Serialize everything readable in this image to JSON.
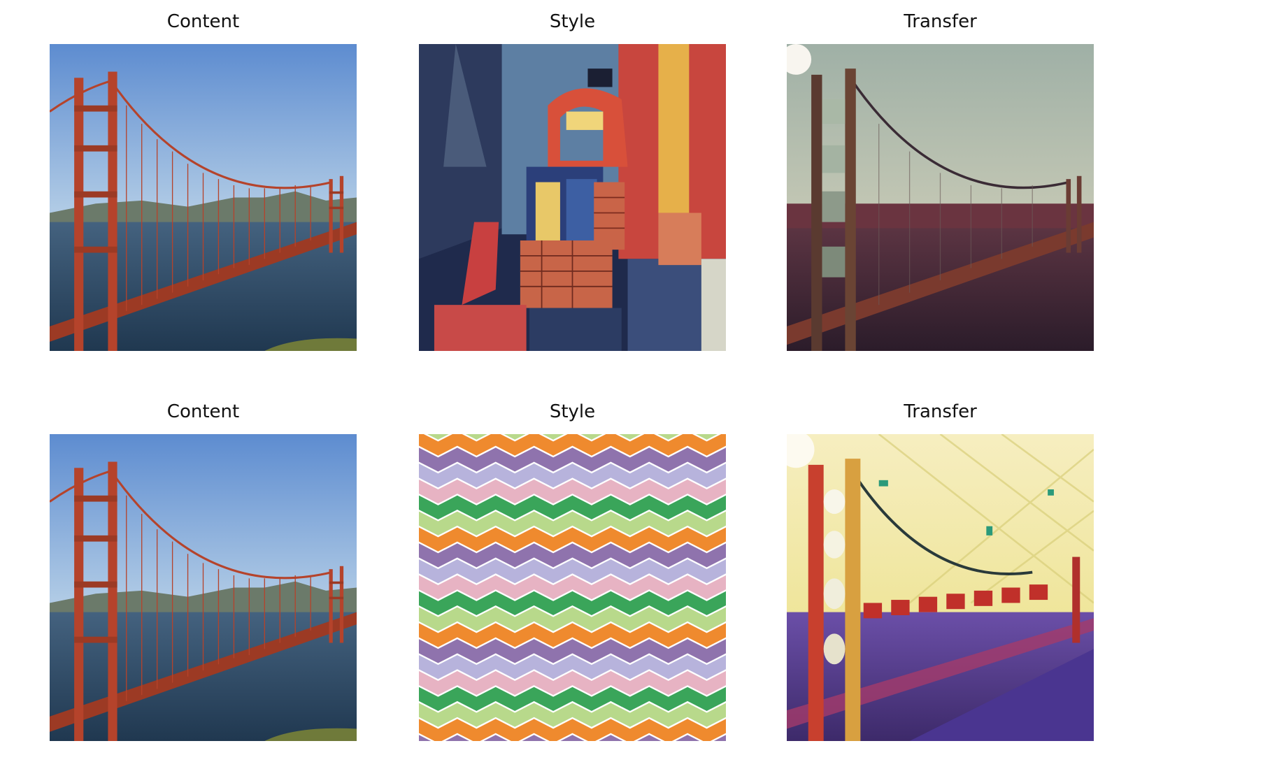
{
  "figure": {
    "panels": [
      {
        "title": "Content",
        "image": "golden-gate-bridge-photo"
      },
      {
        "title": "Style",
        "image": "cubist-painting"
      },
      {
        "title": "Transfer",
        "image": "bridge-cubist-stylized"
      },
      {
        "title": "Content",
        "image": "golden-gate-bridge-photo"
      },
      {
        "title": "Style",
        "image": "chevron-zigzag-pattern"
      },
      {
        "title": "Transfer",
        "image": "bridge-chevron-stylized"
      }
    ]
  },
  "colors": {
    "sky_top": "#5f8fd0",
    "sky_bottom": "#a9c6e3",
    "bridge": "#b5432b",
    "water": "#2f4a66",
    "chevron_green": "#3aa55a",
    "chevron_lightgreen": "#b8d98b",
    "chevron_orange": "#ef8a2e",
    "chevron_purple": "#8f73ad",
    "chevron_lavender": "#b7b3dc",
    "chevron_pink": "#e7b3c3"
  }
}
